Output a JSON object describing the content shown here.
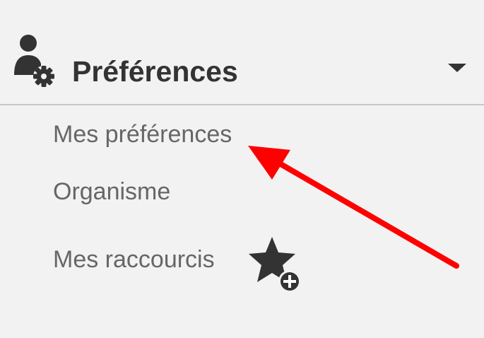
{
  "panel": {
    "header": {
      "title": "Préférences",
      "icon": "user-gear-icon",
      "toggle_icon": "caret-down-icon"
    },
    "items": [
      {
        "label": "Mes préférences"
      },
      {
        "label": "Organisme"
      },
      {
        "label": "Mes raccourcis",
        "icon": "star-plus-icon"
      }
    ]
  },
  "annotation": {
    "icon": "arrow-icon",
    "color": "#ff0000"
  },
  "colors": {
    "background": "#f2f2f2",
    "title": "#333333",
    "item_text": "#666666",
    "divider": "#c7c7c7",
    "icon": "#333333"
  }
}
